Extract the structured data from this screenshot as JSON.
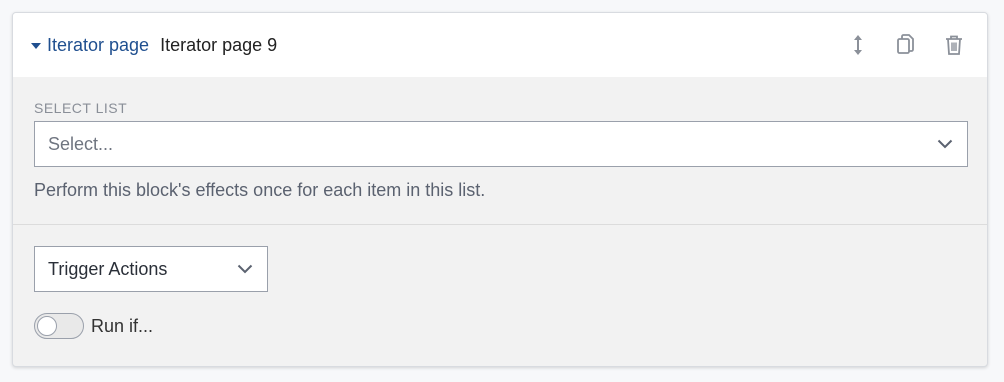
{
  "header": {
    "block_type": "Iterator page",
    "block_name": "Iterator page 9",
    "actions": [
      {
        "name": "move-icon",
        "label": "Move"
      },
      {
        "name": "copy-icon",
        "label": "Copy"
      },
      {
        "name": "trash-icon",
        "label": "Delete"
      }
    ]
  },
  "select_list": {
    "label": "SELECT LIST",
    "placeholder": "Select...",
    "help": "Perform this block's effects once for each item in this list."
  },
  "actions_select": {
    "value": "Trigger Actions"
  },
  "run_if": {
    "label": "Run if...",
    "enabled": false
  },
  "colors": {
    "accent": "#1f4f8f",
    "card_bg": "#f2f2f2",
    "header_bg": "#ffffff",
    "border": "#9aa0ab"
  }
}
